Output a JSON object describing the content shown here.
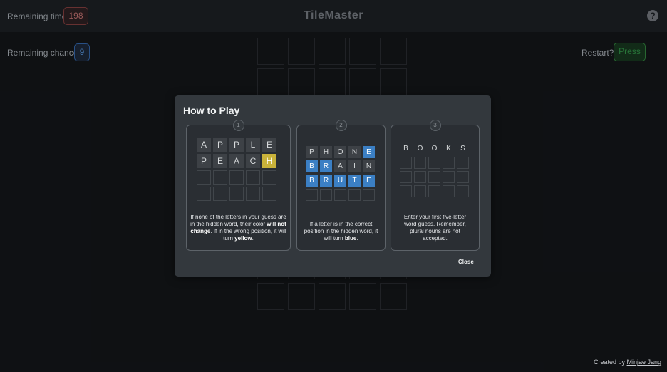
{
  "header": {
    "remaining_time_label": "Remaining time",
    "remaining_time_value": "198",
    "title": "TileMaster",
    "help_icon": "question-circle-icon",
    "remaining_chance_label": "Remaining chance",
    "remaining_chance_value": "9",
    "restart_label": "Restart?",
    "press_label": "Press"
  },
  "modal": {
    "title": "How to Play",
    "close_label": "Close",
    "cards": [
      {
        "step": "1",
        "rows": [
          [
            "A",
            "P",
            "P",
            "L",
            "E"
          ],
          [
            "P",
            "E",
            "A",
            "C",
            "H"
          ]
        ],
        "text_1": "If none of the letters in your guess are in the hidden word, their color ",
        "text_bold_1": "will not change",
        "text_2": ". If in the wrong position, it will turn ",
        "text_bold_2": "yellow",
        "text_3": "."
      },
      {
        "step": "2",
        "rows": [
          [
            "P",
            "H",
            "O",
            "N",
            "E"
          ],
          [
            "B",
            "R",
            "A",
            "I",
            "N"
          ],
          [
            "B",
            "R",
            "U",
            "T",
            "E"
          ]
        ],
        "text_1": "If a letter is in the correct position in the hidden word, it will turn ",
        "text_bold_1": "blue",
        "text_2": "."
      },
      {
        "step": "3",
        "rows": [
          [
            "B",
            "O",
            "O",
            "K",
            "S"
          ]
        ],
        "text_1": "Enter your first five-letter word guess. Remember, plural nouns are not accepted."
      }
    ]
  },
  "footer": {
    "credit_prefix": "Created by ",
    "credit_name": "Minjae Jang"
  },
  "colors": {
    "yellow": "#c9b23a",
    "blue": "#3b7fc4",
    "time_badge": "#7a3a3a",
    "chance_badge": "#2f5f9e",
    "press_button": "#2f7a3a"
  }
}
